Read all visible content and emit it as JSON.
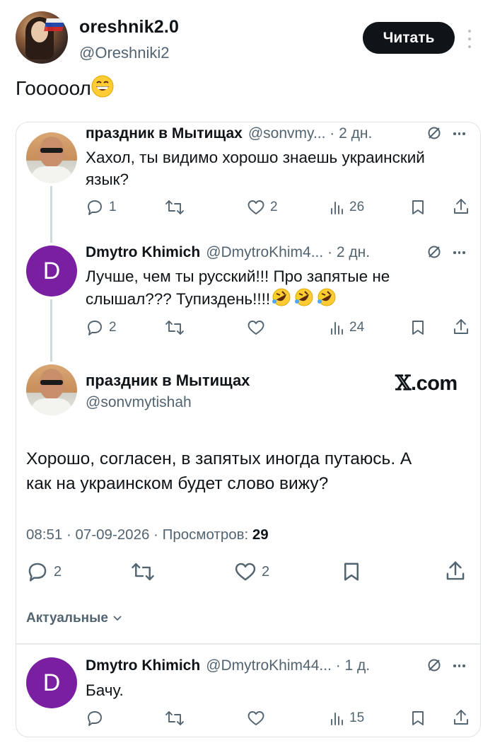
{
  "post": {
    "author_name": "oreshnik2.0",
    "author_handle": "@Oreshniki2",
    "follow_label": "Читать",
    "text": "Гооооол",
    "text_emoji": "grinning-face-emoji"
  },
  "replies": [
    {
      "name": "праздник в Мытищах",
      "meta": "@sonvmy... · 2 дн.",
      "text_lines": [
        "Хахол, ты видимо хорошо знаешь украинский",
        "язык?"
      ],
      "replies": "1",
      "retweets": "",
      "likes": "2",
      "views": "26"
    },
    {
      "name": "Dmytro Khimich",
      "avatar_letter": "D",
      "meta": "@DmytroKhim4... · 2 дн.",
      "text_lines": [
        "Лучше, чем ты русский!!! Про запятые не",
        "слышал??? Тупиздень!!!!"
      ],
      "text_emojis": [
        "rolling-laughing-emoji",
        "rolling-laughing-emoji",
        "rolling-laughing-emoji"
      ],
      "replies": "2",
      "retweets": "",
      "likes": "",
      "views": "24"
    }
  ],
  "focus": {
    "name": "праздник в Мытищах",
    "handle": "@sonvmytishah",
    "xcom": ".com",
    "text_lines": [
      "Хорошо, согласен, в запятых иногда путаюсь. А",
      "как на украинском будет слово вижу?"
    ],
    "time": "08:51 · 07-09-2026 · Просмотров: ",
    "views": "29",
    "replies": "2",
    "likes": "2"
  },
  "sort_label": "Актуальные",
  "bottom_reply": {
    "name": "Dmytro Khimich",
    "avatar_letter": "D",
    "meta": "@DmytroKhim44... · 1 д.",
    "text": "Бачу.",
    "views": "15"
  },
  "colors": {
    "text": "#0f1419",
    "secondary": "#536471",
    "avatar_d": "#7a1fa2",
    "button_bg": "#0f1419",
    "border": "#dfe3e6"
  }
}
